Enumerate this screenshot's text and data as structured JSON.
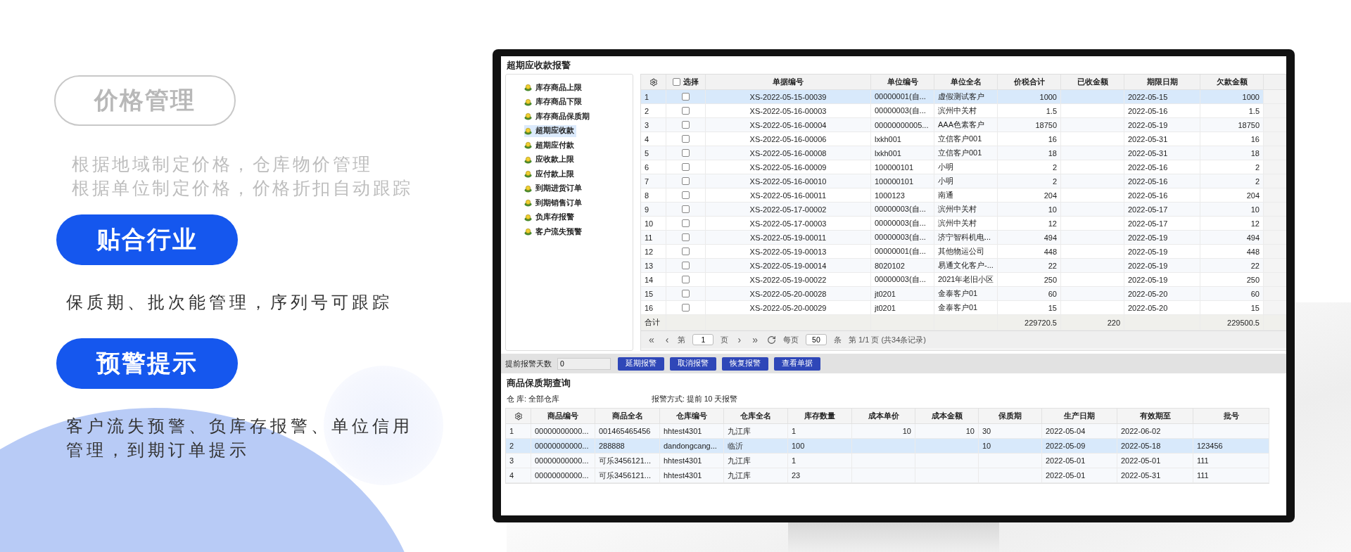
{
  "features": [
    {
      "tag": "价格管理",
      "kind": "outline",
      "lines": [
        "根据地域制定价格，仓库物价管理",
        "根据单位制定价格，价格折扣自动跟踪"
      ]
    },
    {
      "tag": "贴合行业",
      "kind": "filled",
      "lines": [
        "保质期、批次能管理，序列号可跟踪"
      ]
    },
    {
      "tag": "预警提示",
      "kind": "filled",
      "lines": [
        "客户流失预警、负库存报警、单位信用管理，到期订单提示"
      ]
    }
  ],
  "window": {
    "title": "超期应收款报警"
  },
  "tree": [
    {
      "label": "库存商品上限",
      "selected": false
    },
    {
      "label": "库存商品下限",
      "selected": false
    },
    {
      "label": "库存商品保质期",
      "selected": false
    },
    {
      "label": "超期应收款",
      "selected": true
    },
    {
      "label": "超期应付款",
      "selected": false
    },
    {
      "label": "应收款上限",
      "selected": false
    },
    {
      "label": "应付款上限",
      "selected": false
    },
    {
      "label": "到期进货订单",
      "selected": false
    },
    {
      "label": "到期销售订单",
      "selected": false
    },
    {
      "label": "负库存报警",
      "selected": false
    },
    {
      "label": "客户流失预警",
      "selected": false
    }
  ],
  "grid": {
    "select_label": "选择",
    "select_all": false,
    "columns": [
      {
        "label": "单据编号",
        "kind": "center"
      },
      {
        "label": "单位编号",
        "kind": "text"
      },
      {
        "label": "单位全名",
        "kind": "text"
      },
      {
        "label": "价税合计",
        "kind": "number"
      },
      {
        "label": "已收金额",
        "kind": "number"
      },
      {
        "label": "期限日期",
        "kind": "text"
      },
      {
        "label": "欠款金额",
        "kind": "number"
      }
    ],
    "rows": [
      {
        "no": "1",
        "selected": true,
        "checked": false,
        "cells": [
          "XS-2022-05-15-00039",
          "00000001(自...",
          "虚假测试客户",
          "1000",
          null,
          "2022-05-15",
          "1000"
        ]
      },
      {
        "no": "2",
        "selected": false,
        "checked": false,
        "cells": [
          "XS-2022-05-16-00003",
          "00000003(自...",
          "滨州中关村",
          "1.5",
          null,
          "2022-05-16",
          "1.5"
        ]
      },
      {
        "no": "3",
        "selected": false,
        "checked": false,
        "cells": [
          "XS-2022-05-16-00004",
          "00000000005...",
          "AAA色素客户",
          "18750",
          null,
          "2022-05-19",
          "18750"
        ]
      },
      {
        "no": "4",
        "selected": false,
        "checked": false,
        "cells": [
          "XS-2022-05-16-00006",
          "lxkh001",
          "立信客户001",
          "16",
          null,
          "2022-05-31",
          "16"
        ]
      },
      {
        "no": "5",
        "selected": false,
        "checked": false,
        "cells": [
          "XS-2022-05-16-00008",
          "lxkh001",
          "立信客户001",
          "18",
          null,
          "2022-05-31",
          "18"
        ]
      },
      {
        "no": "6",
        "selected": false,
        "checked": false,
        "cells": [
          "XS-2022-05-16-00009",
          "100000101",
          "小明",
          "2",
          null,
          "2022-05-16",
          "2"
        ]
      },
      {
        "no": "7",
        "selected": false,
        "checked": false,
        "cells": [
          "XS-2022-05-16-00010",
          "100000101",
          "小明",
          "2",
          null,
          "2022-05-16",
          "2"
        ]
      },
      {
        "no": "8",
        "selected": false,
        "checked": false,
        "cells": [
          "XS-2022-05-16-00011",
          "1000123",
          "南通",
          "204",
          null,
          "2022-05-16",
          "204"
        ]
      },
      {
        "no": "9",
        "selected": false,
        "checked": false,
        "cells": [
          "XS-2022-05-17-00002",
          "00000003(自...",
          "滨州中关村",
          "10",
          null,
          "2022-05-17",
          "10"
        ]
      },
      {
        "no": "10",
        "selected": false,
        "checked": false,
        "cells": [
          "XS-2022-05-17-00003",
          "00000003(自...",
          "滨州中关村",
          "12",
          null,
          "2022-05-17",
          "12"
        ]
      },
      {
        "no": "11",
        "selected": false,
        "checked": false,
        "cells": [
          "XS-2022-05-19-00011",
          "00000003(自...",
          "济宁智科机电...",
          "494",
          null,
          "2022-05-19",
          "494"
        ]
      },
      {
        "no": "12",
        "selected": false,
        "checked": false,
        "cells": [
          "XS-2022-05-19-00013",
          "00000001(自...",
          "其他物运公司",
          "448",
          null,
          "2022-05-19",
          "448"
        ]
      },
      {
        "no": "13",
        "selected": false,
        "checked": false,
        "cells": [
          "XS-2022-05-19-00014",
          "8020102",
          "易通文化客户-...",
          "22",
          null,
          "2022-05-19",
          "22"
        ]
      },
      {
        "no": "14",
        "selected": false,
        "checked": false,
        "cells": [
          "XS-2022-05-19-00022",
          "00000003(自...",
          "2021年老旧小区",
          "250",
          null,
          "2022-05-19",
          "250"
        ]
      },
      {
        "no": "15",
        "selected": false,
        "checked": false,
        "cells": [
          "XS-2022-05-20-00028",
          "jt0201",
          "金泰客户01",
          "60",
          null,
          "2022-05-20",
          "60"
        ]
      },
      {
        "no": "16",
        "selected": false,
        "checked": false,
        "cells": [
          "XS-2022-05-20-00029",
          "jt0201",
          "金泰客户01",
          "15",
          null,
          "2022-05-20",
          "15"
        ]
      }
    ],
    "totals": {
      "label": "合计",
      "cells": [
        null,
        null,
        null,
        "229720.5",
        "220",
        null,
        "229500.5"
      ]
    },
    "pager": {
      "first": "«",
      "prev": "‹",
      "page_prefix": "第",
      "page": "1",
      "page_suffix": "页",
      "next": "›",
      "last": "»",
      "per_page_label": "每页",
      "per_page": "50",
      "per_page_suffix": "条",
      "summary": "第 1/1 页 (共34条记录)"
    }
  },
  "toolbar": {
    "days_label": "提前报警天数",
    "days": "0",
    "buttons": [
      "延期报警",
      "取消报警",
      "恢复报警",
      "查看单据"
    ]
  },
  "shelf": {
    "title": "商品保质期查询",
    "warehouse": "仓 库: 全部仓库",
    "mode": "报警方式: 提前 10 天报警",
    "columns": [
      {
        "label": "商品编号",
        "kind": "text"
      },
      {
        "label": "商品全名",
        "kind": "text"
      },
      {
        "label": "仓库编号",
        "kind": "text"
      },
      {
        "label": "仓库全名",
        "kind": "text"
      },
      {
        "label": "库存数量",
        "kind": "text"
      },
      {
        "label": "成本单价",
        "kind": "number"
      },
      {
        "label": "成本金额",
        "kind": "number"
      },
      {
        "label": "保质期",
        "kind": "text"
      },
      {
        "label": "生产日期",
        "kind": "text"
      },
      {
        "label": "有效期至",
        "kind": "text"
      },
      {
        "label": "批号",
        "kind": "text"
      }
    ],
    "rows": [
      {
        "no": "1",
        "selected": false,
        "cells": [
          "00000000000...",
          "001465465456",
          "hhtest4301",
          "九江库",
          "1",
          "10",
          "10",
          "30",
          "2022-05-04",
          "2022-06-02",
          null
        ]
      },
      {
        "no": "2",
        "selected": true,
        "cells": [
          "00000000000...",
          "288888",
          "dandongcang...",
          "临沂",
          "100",
          null,
          null,
          "10",
          "2022-05-09",
          "2022-05-18",
          "123456"
        ]
      },
      {
        "no": "3",
        "selected": false,
        "cells": [
          "00000000000...",
          "可乐3456121...",
          "hhtest4301",
          "九江库",
          "1",
          null,
          null,
          null,
          "2022-05-01",
          "2022-05-01",
          "111"
        ]
      },
      {
        "no": "4",
        "selected": false,
        "cells": [
          "00000000000...",
          "可乐3456121...",
          "hhtest4301",
          "九江库",
          "23",
          null,
          null,
          null,
          "2022-05-01",
          "2022-05-31",
          "111"
        ]
      }
    ]
  }
}
